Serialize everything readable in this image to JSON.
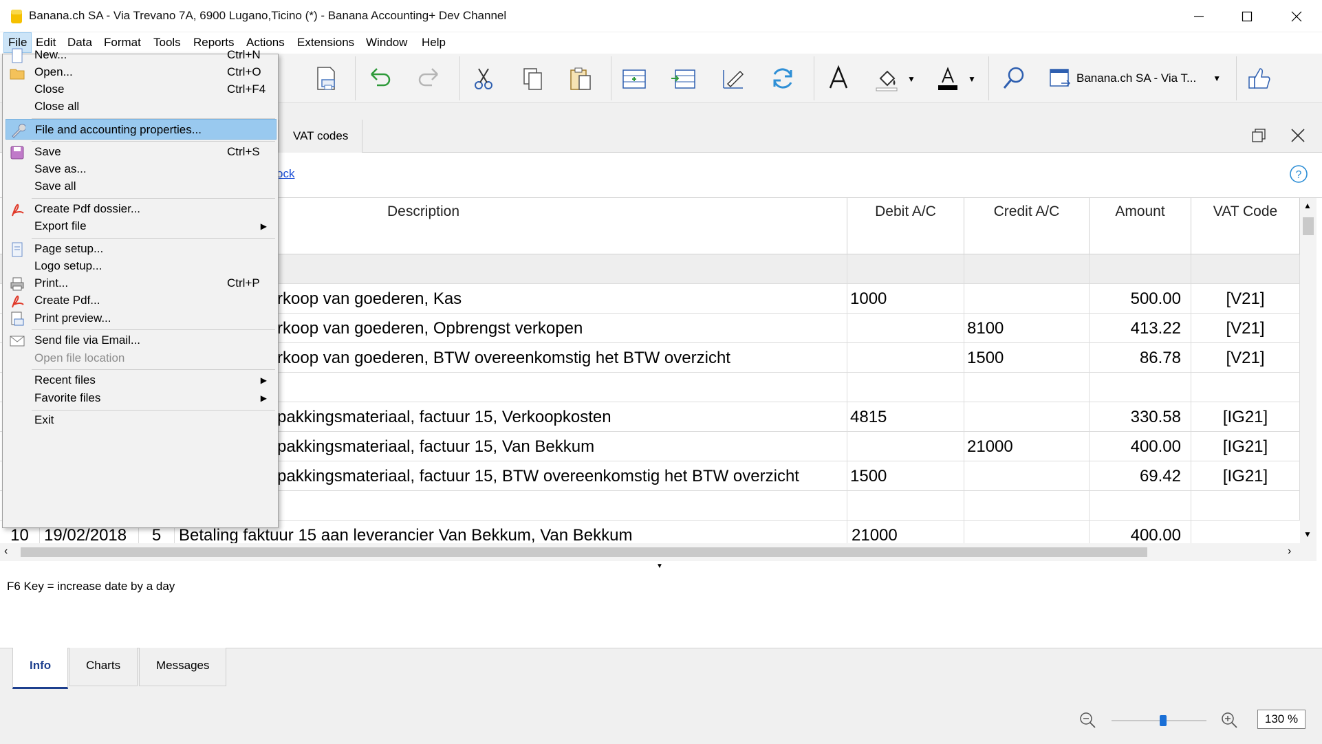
{
  "window": {
    "title": "Banana.ch SA - Via Trevano 7A, 6900 Lugano,Ticino (*) - Banana Accounting+ Dev Channel"
  },
  "menubar": [
    "File",
    "Edit",
    "Data",
    "Format",
    "Tools",
    "Reports",
    "Actions",
    "Extensions",
    "Window",
    "Help"
  ],
  "toolbar": {
    "file_selector_label": "Banana.ch SA - Via T..."
  },
  "tabs": {
    "vat_codes": "VAT codes"
  },
  "link_fragment": "ock",
  "table": {
    "columns": [
      "Description",
      "Debit A/C",
      "Credit A/C",
      "Amount",
      "VAT Code"
    ],
    "rows": [
      {
        "desc": "",
        "debit": "",
        "credit": "",
        "amount": "",
        "vat": ""
      },
      {
        "desc": "rkoop van goederen, Kas",
        "debit": "1000",
        "credit": "",
        "amount": "500.00",
        "vat": "[V21]"
      },
      {
        "desc": "rkoop van goederen, Opbrengst verkopen",
        "debit": "",
        "credit": "8100",
        "amount": "413.22",
        "vat": "[V21]"
      },
      {
        "desc": "rkoop van goederen, BTW overeenkomstig het BTW overzicht",
        "debit": "",
        "credit": "1500",
        "amount": "86.78",
        "vat": "[V21]"
      },
      {
        "desc": "",
        "debit": "",
        "credit": "",
        "amount": "",
        "vat": ""
      },
      {
        "desc": "pakkingsmateriaal, factuur 15, Verkoopkosten",
        "debit": "4815",
        "credit": "",
        "amount": "330.58",
        "vat": "[IG21]"
      },
      {
        "desc": "pakkingsmateriaal, factuur 15, Van Bekkum",
        "debit": "",
        "credit": "21000",
        "amount": "400.00",
        "vat": "[IG21]"
      },
      {
        "desc": "pakkingsmateriaal, factuur 15, BTW overeenkomstig het BTW overzicht",
        "debit": "1500",
        "credit": "",
        "amount": "69.42",
        "vat": "[IG21]"
      },
      {
        "desc": "",
        "debit": "",
        "credit": "",
        "amount": "",
        "vat": ""
      }
    ],
    "partial_row": {
      "num": "10",
      "date": "19/02/2018",
      "doc": "5",
      "desc": "Betaling faktuur 15 aan leverancier Van Bekkum, Van Bekkum",
      "debit": "21000",
      "amount": "400.00"
    }
  },
  "info": {
    "text": "F6 Key = increase date by a day"
  },
  "bottom_tabs": [
    "Info",
    "Charts",
    "Messages"
  ],
  "zoom": {
    "value": "130 %",
    "level": 0.55
  },
  "file_menu": {
    "items": [
      {
        "label": "New...",
        "shortcut": "Ctrl+N"
      },
      {
        "label": "Open...",
        "shortcut": "Ctrl+O"
      },
      {
        "label": "Close",
        "shortcut": "Ctrl+F4"
      },
      {
        "label": "Close all",
        "shortcut": ""
      },
      {
        "label": "File and accounting properties...",
        "shortcut": ""
      },
      {
        "label": "Save",
        "shortcut": "Ctrl+S"
      },
      {
        "label": "Save as...",
        "shortcut": ""
      },
      {
        "label": "Save all",
        "shortcut": ""
      },
      {
        "label": "Create Pdf dossier...",
        "shortcut": ""
      },
      {
        "label": "Export file",
        "shortcut": ""
      },
      {
        "label": "Page setup...",
        "shortcut": ""
      },
      {
        "label": "Logo setup...",
        "shortcut": ""
      },
      {
        "label": "Print...",
        "shortcut": "Ctrl+P"
      },
      {
        "label": "Create Pdf...",
        "shortcut": ""
      },
      {
        "label": "Print preview...",
        "shortcut": ""
      },
      {
        "label": "Send file via Email...",
        "shortcut": ""
      },
      {
        "label": "Open file location",
        "shortcut": ""
      },
      {
        "label": "Recent files",
        "shortcut": ""
      },
      {
        "label": "Favorite files",
        "shortcut": ""
      },
      {
        "label": "Exit",
        "shortcut": ""
      }
    ]
  }
}
